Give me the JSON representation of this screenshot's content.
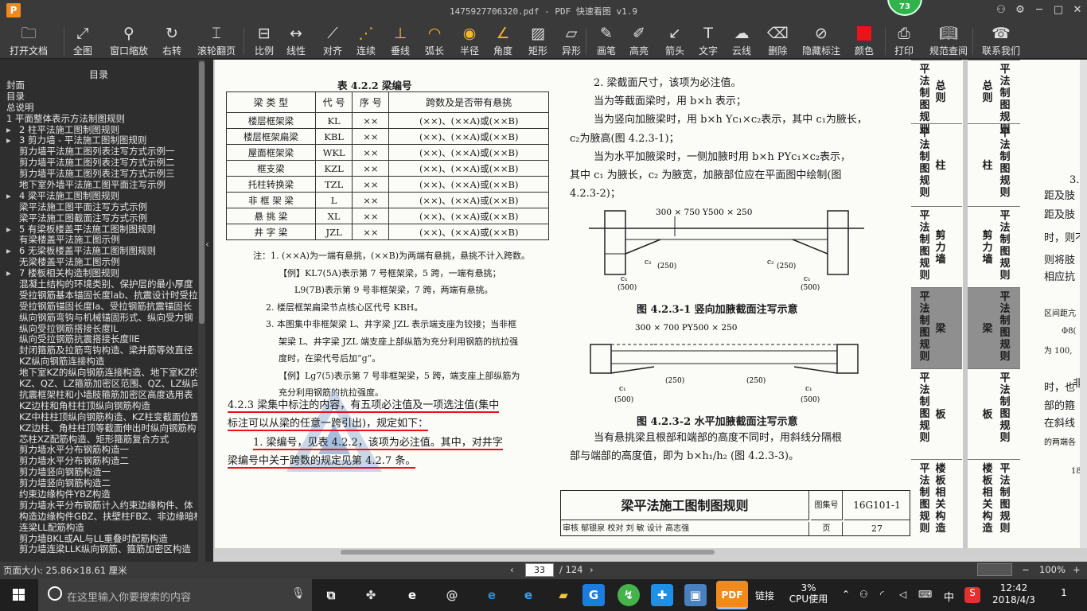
{
  "window": {
    "title": "1475927706320.pdf - PDF 快速看图 v1.9",
    "badge": "73"
  },
  "toolbar": {
    "buttons": [
      {
        "label": "打开文档",
        "icon": "folder-icon"
      },
      {
        "label": "全图",
        "icon": "fit-all-icon"
      },
      {
        "label": "窗口缩放",
        "icon": "zoom-icon"
      },
      {
        "label": "右转",
        "icon": "rotate-right-icon"
      },
      {
        "label": "滚轮翻页",
        "icon": "mouse-wheel-icon"
      },
      {
        "label": "比例",
        "icon": "scale-icon"
      },
      {
        "label": "线性",
        "icon": "linear-icon"
      },
      {
        "label": "对齐",
        "icon": "align-icon"
      },
      {
        "label": "连续",
        "icon": "continuous-icon"
      },
      {
        "label": "垂线",
        "icon": "perpendicular-icon"
      },
      {
        "label": "弧长",
        "icon": "arc-length-icon"
      },
      {
        "label": "半径",
        "icon": "radius-icon"
      },
      {
        "label": "角度",
        "icon": "angle-icon"
      },
      {
        "label": "矩形",
        "icon": "rectangle-icon"
      },
      {
        "label": "异形",
        "icon": "irregular-icon"
      },
      {
        "label": "画笔",
        "icon": "pen-icon"
      },
      {
        "label": "高亮",
        "icon": "highlight-icon"
      },
      {
        "label": "箭头",
        "icon": "arrow-icon"
      },
      {
        "label": "文字",
        "icon": "text-icon"
      },
      {
        "label": "云线",
        "icon": "cloud-icon"
      },
      {
        "label": "删除",
        "icon": "eraser-icon"
      },
      {
        "label": "隐藏标注",
        "icon": "hide-icon"
      },
      {
        "label": "颜色",
        "icon": "color-icon",
        "color": "#e8141a"
      },
      {
        "label": "打印",
        "icon": "print-icon"
      },
      {
        "label": "规范查阅",
        "icon": "book-icon"
      },
      {
        "label": "联系我们",
        "icon": "contact-icon"
      }
    ]
  },
  "sidebar": {
    "header": "目录",
    "toc": [
      {
        "text": "封面",
        "level": 0
      },
      {
        "text": "目录",
        "level": 0
      },
      {
        "text": "总说明",
        "level": 0
      },
      {
        "text": "1 平面整体表示方法制图规则",
        "level": 0
      },
      {
        "text": "2 柱平法施工图制图规则",
        "level": 0,
        "arrow": "▸"
      },
      {
        "text": "3 剪力墙 - 平法施工图制图规则",
        "level": 0,
        "arrow": "▸"
      },
      {
        "text": "剪力墙平法施工图列表注写方式示例一",
        "level": 1
      },
      {
        "text": "剪力墙平法施工图列表注写方式示例二",
        "level": 1
      },
      {
        "text": "剪力墙平法施工图列表注写方式示例三",
        "level": 1
      },
      {
        "text": "地下室外墙平法施工图平面注写示例",
        "level": 1
      },
      {
        "text": "4 梁平法施工图制图规则",
        "level": 0,
        "arrow": "▸"
      },
      {
        "text": "梁平法施工图平面注写方式示例",
        "level": 1
      },
      {
        "text": "梁平法施工图截面注写方式示例",
        "level": 1
      },
      {
        "text": "5 有梁板楼盖平法施工图制图规则",
        "level": 0,
        "arrow": "▸"
      },
      {
        "text": "有梁楼盖平法施工图示例",
        "level": 1
      },
      {
        "text": "6 无梁板楼盖平法施工图制图规则",
        "level": 0,
        "arrow": "▸"
      },
      {
        "text": "无梁楼盖平法施工图示例",
        "level": 1
      },
      {
        "text": "7 楼板相关构造制图规则",
        "level": 0,
        "arrow": "▸"
      },
      {
        "text": "混凝土结构的环境类别、保护层的最小厚度",
        "level": 1
      },
      {
        "text": "受拉钢筋基本锚固长度lab、抗震设计时受拉",
        "level": 1
      },
      {
        "text": "受拉钢筋锚固长度la、受拉钢筋抗震锚固长",
        "level": 1
      },
      {
        "text": "纵向钢筋弯钩与机械锚固形式、纵向受力钢",
        "level": 1
      },
      {
        "text": "纵向受拉钢筋搭接长度lL",
        "level": 1
      },
      {
        "text": "纵向受拉钢筋抗震搭接长度llE",
        "level": 1
      },
      {
        "text": "封闭箍筋及拉筋弯钩构造、梁并筋等效直径",
        "level": 1
      },
      {
        "text": "KZ纵向钢筋连接构造",
        "level": 1
      },
      {
        "text": "地下室KZ的纵向钢筋连接构造、地下室KZ的",
        "level": 1
      },
      {
        "text": "KZ、QZ、LZ箍筋加密区范围、QZ、LZ纵向钢",
        "level": 1
      },
      {
        "text": "抗震框架柱和小墙肢箍筋加密区高度选用表",
        "level": 1
      },
      {
        "text": "KZ边柱和角柱柱顶纵向钢筋构造",
        "level": 1
      },
      {
        "text": "KZ中柱柱顶纵向钢筋构造、KZ柱变截面位置",
        "level": 1
      },
      {
        "text": "KZ边柱、角柱柱顶等截面伸出时纵向钢筋构",
        "level": 1
      },
      {
        "text": "芯柱XZ配筋构造、矩形箍筋复合方式",
        "level": 1
      },
      {
        "text": "剪力墙水平分布钢筋构造一",
        "level": 1
      },
      {
        "text": "剪力墙水平分布钢筋构造二",
        "level": 1
      },
      {
        "text": "剪力墙竖向钢筋构造一",
        "level": 1
      },
      {
        "text": "剪力墙竖向钢筋构造二",
        "level": 1
      },
      {
        "text": "约束边缘构件YBZ构造",
        "level": 1
      },
      {
        "text": "剪力墙水平分布钢筋计入约束边缘构件、体",
        "level": 1
      },
      {
        "text": "构造边缘构件GBZ、扶壁柱FBZ、非边缘暗柱",
        "level": 1
      },
      {
        "text": "连梁LL配筋构造",
        "level": 1
      },
      {
        "text": "剪力墙BKL或AL与LL重叠时配筋构造",
        "level": 1
      },
      {
        "text": "剪力墙连梁LLK纵向钢筋、箍筋加密区构造",
        "level": 1
      }
    ]
  },
  "page": {
    "table_title": "表 4.2.2   梁编号",
    "table_headers": [
      "梁 类 型",
      "代 号",
      "序 号",
      "跨数及是否带有悬挑"
    ],
    "table_rows": [
      [
        "楼层框架梁",
        "KL",
        "××",
        "(××)、(××A)或(××B)"
      ],
      [
        "楼层框架扁梁",
        "KBL",
        "××",
        "(××)、(××A)或(××B)"
      ],
      [
        "屋面框架梁",
        "WKL",
        "××",
        "(××)、(××A)或(××B)"
      ],
      [
        "框支梁",
        "KZL",
        "××",
        "(××)、(××A)或(××B)"
      ],
      [
        "托柱转换梁",
        "TZL",
        "××",
        "(××)、(××A)或(××B)"
      ],
      [
        "非 框 架 梁",
        "L",
        "××",
        "(××)、(××A)或(××B)"
      ],
      [
        "悬 挑 梁",
        "XL",
        "××",
        "(××)、(××A)或(××B)"
      ],
      [
        "井 字 梁",
        "JZL",
        "××",
        "(××)、(××A)或(××B)"
      ]
    ],
    "notes": [
      "注：1. (××A)为一端有悬挑，(××B)为两端有悬挑，悬挑不计入跨数。",
      "【例】KL7(5A)表示第 7 号框架梁，5 跨，一端有悬挑；",
      "L9(7B)表示第 9 号非框架梁，7 跨，两端有悬挑。",
      "2. 楼层框架扁梁节点核心区代号 KBH。",
      "3. 本图集中非框架梁 L、井字梁 JZL 表示端支座为铰接；当非框",
      "架梁 L、井字梁 JZL 端支座上部纵筋为充分利用钢筋的抗拉强",
      "度时，在梁代号后加“g”。",
      "【例】Lg7(5)表示第 7 号非框架梁，5 跨，端支座上部纵筋为",
      "充分利用钢筋的抗拉强度。"
    ],
    "para_423_a": "4.2.3  梁集中标注的内容，有五项必注值及一项选注值(集中",
    "para_423_b": "标注可以从梁的任意一跨引出)，规定如下：",
    "para_1_a": "1. 梁编号，见表 4.2.2，该项为必注值。其中，对井字",
    "para_1_b": "梁编号中关于跨数的规定见第 4.2.7 条。",
    "right_lines": [
      "2. 梁截面尺寸，该项为必注值。",
      "当为等截面梁时，用 b×h 表示；",
      "当为竖向加腋梁时，用 b×h  Yc₁×c₂表示，其中 c₁为腋长，",
      "c₂为腋高(图 4.2.3-1)；",
      "当为水平加腋梁时，一侧加腋时用 b×h  PYc₁×c₂表示，",
      "其中 c₁ 为腋长，c₂ 为腋宽，加腋部位应在平面图中绘制(图",
      "4.2.3-2)；"
    ],
    "fig1_label": "300 × 750  Y500 × 250",
    "fig1_caption": "图 4.2.3-1  竖向加腋截面注写示意",
    "fig2_label": "300 × 700  PY500 × 250",
    "fig2_caption": "图 4.2.3-2  水平加腋截面注写示意",
    "dim_c1": "c₁",
    "dim_c2": "c₂",
    "dim_250": "(250)",
    "dim_500": "(500)",
    "after_lines": [
      "当有悬挑梁且根部和端部的高度不同时，用斜线分隔根",
      "部与端部的高度值，即为 b×h₁/h₂ (图 4.2.3-3)。"
    ],
    "tb_title": "梁平法施工图制图规则",
    "tb_set_label": "图集号",
    "tb_set": "16G101-1",
    "tb_page_label": "页",
    "tb_page": "27",
    "tb_sign": "审核 郁银泉 校对 刘  敏  设计 高志强",
    "tabs": [
      {
        "left": "平法制图规则",
        "right": "总则"
      },
      {
        "left": "平法制图规则",
        "right": "柱"
      },
      {
        "left": "平法制图规则",
        "right": "剪力墙"
      },
      {
        "left": "平法制图规则",
        "right": "梁"
      },
      {
        "left": "平法制图规则",
        "right": "板"
      },
      {
        "left": "平法制图规则",
        "right": "楼板相关构造"
      }
    ]
  },
  "page2": {
    "lines": [
      "距及肢",
      "距及肢",
      "时，则不",
      "则将肢",
      "相应抗",
      "区间距亢",
      "Φ8(",
      "为 100,",
      "非",
      "时，也",
      "部的箍",
      "在斜线",
      "的两端各",
      "18("
    ],
    "top_num": "3."
  },
  "statusbar": {
    "page_size": "页面大小: 25.86×18.61 厘米",
    "current_page": "33",
    "total_pages": "/ 124",
    "zoom": "100%"
  },
  "taskbar": {
    "search_placeholder": "在这里输入你要搜索的内容",
    "link_label": "链接",
    "cpu_percent": "3%",
    "cpu_label": "CPU使用",
    "ime": "中",
    "time": "12:42",
    "date": "2018/4/3",
    "notification_count": "1"
  }
}
